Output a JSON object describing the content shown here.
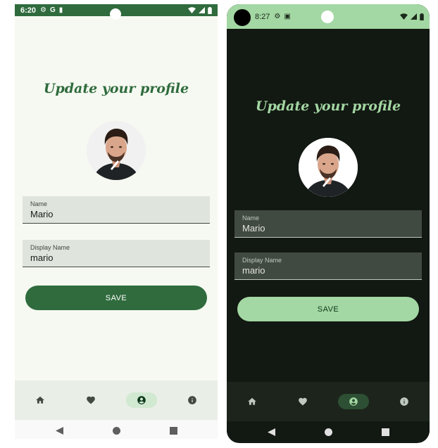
{
  "colors": {
    "light_primary": "#2f6b3d",
    "light_background": "#f6f9f1",
    "dark_primary": "#a3d7a3",
    "dark_background": "#121812"
  },
  "light": {
    "status_time": "6:20",
    "status_icons": [
      "gear-icon",
      "google-icon",
      "sim-card-icon"
    ],
    "title": "Update your profile",
    "name_label": "Name",
    "name_value": "Mario",
    "display_name_label": "Display Name",
    "display_name_value": "mario",
    "save_label": "SAVE"
  },
  "dark": {
    "status_time": "8:27",
    "status_icons": [
      "gear-icon",
      "text-field-icon"
    ],
    "title": "Update your profile",
    "name_label": "Name",
    "name_value": "Mario",
    "display_name_label": "Display Name",
    "display_name_value": "mario",
    "save_label": "SAVE"
  },
  "bottom_nav": {
    "items": [
      "home-icon",
      "heart-icon",
      "account-circle-icon",
      "info-icon"
    ],
    "active_index": 2
  },
  "system_nav": [
    "back-icon",
    "home-circle-icon",
    "recents-icon"
  ]
}
